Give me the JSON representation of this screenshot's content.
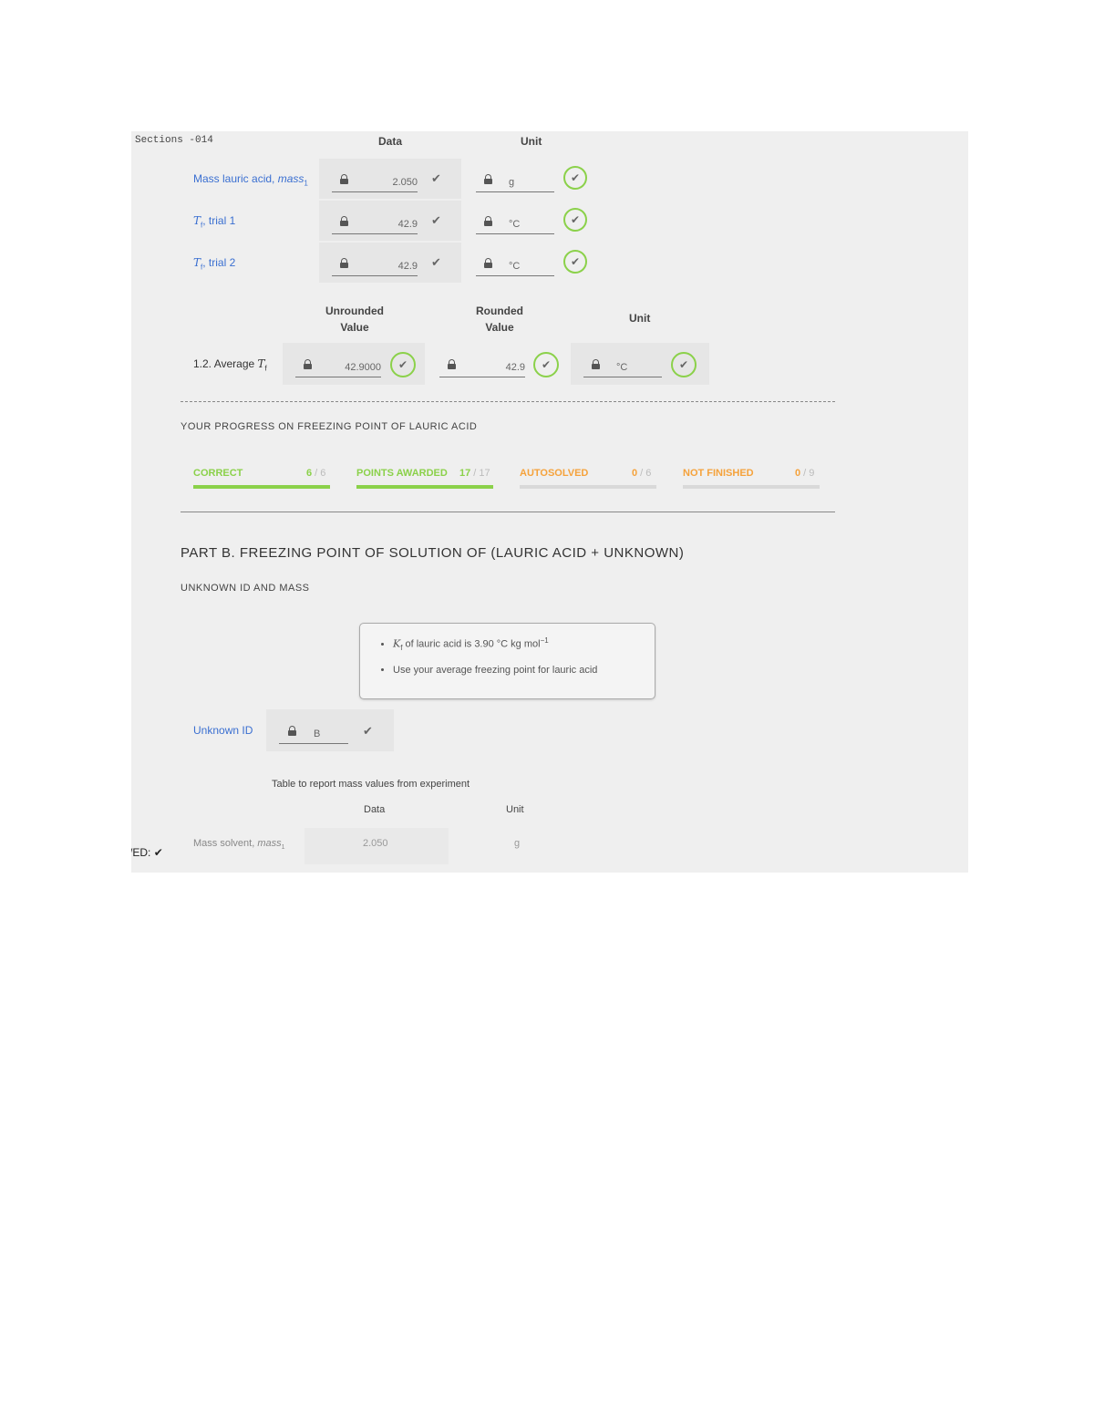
{
  "header": {
    "section": "Sections -014",
    "col_data": "Data",
    "col_unit": "Unit"
  },
  "data_rows": [
    {
      "label_main": "Mass lauric acid, ",
      "label_var": "mass",
      "label_sub": "1",
      "value": "2.050",
      "unit": "g"
    },
    {
      "label_main": ", trial 1",
      "label_var": "T",
      "label_sub": "f",
      "value": "42.9",
      "unit": "°C"
    },
    {
      "label_main": ", trial 2",
      "label_var": "T",
      "label_sub": "f",
      "value": "42.9",
      "unit": "°C"
    }
  ],
  "average": {
    "col_unrounded_1": "Unrounded",
    "col_unrounded_2": "Value",
    "col_rounded_1": "Rounded",
    "col_rounded_2": "Value",
    "col_unit": "Unit",
    "label": "1.2. Average ",
    "label_var": "T",
    "label_sub": "f",
    "unrounded": "42.9000",
    "rounded": "42.9",
    "unit": "°C"
  },
  "progress": {
    "title": "YOUR PROGRESS ON FREEZING POINT OF LAURIC ACID",
    "items": [
      {
        "label": "CORRECT",
        "value": "6",
        "sep": " / ",
        "total": "6",
        "fraction": 1.0
      },
      {
        "label": "POINTS AWARDED",
        "value": "17",
        "sep": " / ",
        "total": "17",
        "fraction": 1.0
      },
      {
        "label": "AUTOSOLVED",
        "value": "0",
        "sep": " / ",
        "total": "6",
        "fraction": 0
      },
      {
        "label": "NOT FINISHED",
        "value": "0",
        "sep": " / ",
        "total": "9",
        "fraction": 0
      }
    ]
  },
  "part_b": {
    "title": "PART B. FREEZING POINT OF SOLUTION OF (LAURIC ACID + UNKNOWN)",
    "subtitle": "UNKNOWN ID AND MASS",
    "note_1_var": "K",
    "note_1_sub": "f",
    "note_1_text": " of lauric acid is 3.90 °C kg mol",
    "note_1_sup": "−1",
    "note_2": "Use your average freezing point for lauric acid",
    "unknown_label": "Unknown ID",
    "unknown_value": "B",
    "table_caption": "Table to report mass values from experiment",
    "table_col_data": "Data",
    "table_col_unit": "Unit",
    "mass_solvent_label": "Mass solvent, ",
    "mass_solvent_var": "mass",
    "mass_solvent_sub": "1",
    "mass_solvent_value": "2.050",
    "mass_solvent_unit": "g"
  },
  "left_clip": "/ED:"
}
